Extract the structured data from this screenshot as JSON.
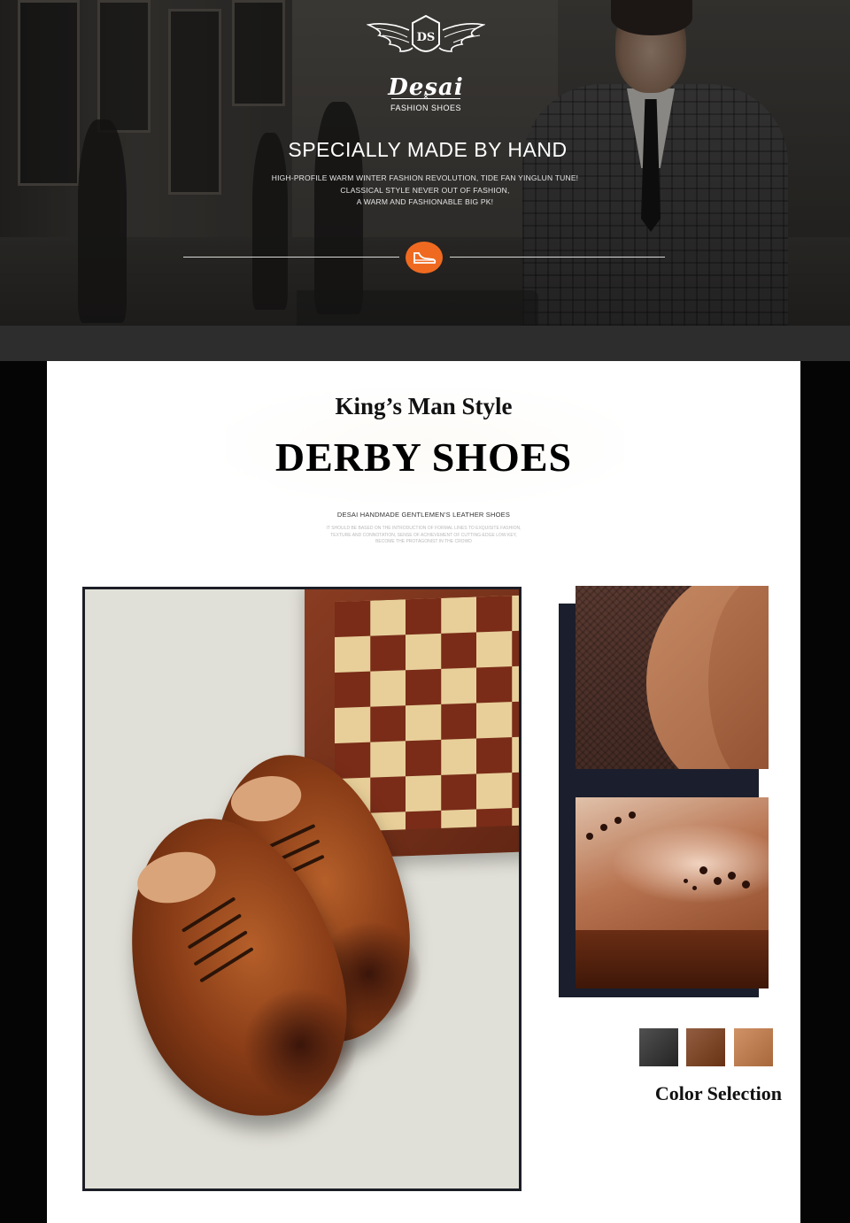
{
  "hero": {
    "brand": "Desai",
    "logo_monogram": "DS",
    "brand_sub": "FASHION SHOES",
    "title": "SPECIALLY MADE BY HAND",
    "lines": [
      "HIGH-PROFILE WARM WINTER FASHION REVOLUTION, TIDE FAN YINGLUN TUNE!",
      "CLASSICAL STYLE NEVER OUT OF FASHION,",
      "A WARM AND FASHIONABLE BIG PK!"
    ],
    "badge_icon": "shoe-icon",
    "accent": "#ef6a20"
  },
  "main": {
    "kicker": "King’s Man Style",
    "title": "DERBY SHOES",
    "subtitle": "DESAI HANDMADE GENTLEMEN'S LEATHER SHOES",
    "fine_print": [
      "IT SHOULD BE BASED ON THE INTRODUCTION OF FORMAL LINES TO EXQUISITE FASHION,",
      "TEXTURE AND CONNOTATION, SENSE OF ACHIEVEMENT OF CUTTING-EDGE LOW KEY,",
      "BECOME THE PROTAGONIST IN THE CROWD"
    ],
    "color_label": "Color Selection",
    "swatches": [
      {
        "name": "black",
        "color": "#2a2a2a"
      },
      {
        "name": "dark-brown",
        "color": "#7a3a17"
      },
      {
        "name": "light-brown",
        "color": "#c57a45"
      }
    ]
  }
}
